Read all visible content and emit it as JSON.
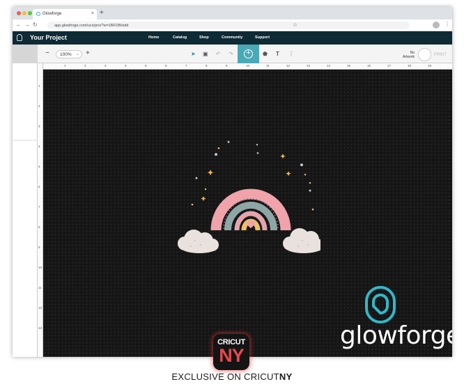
{
  "browser": {
    "tab_title": "Glowforge",
    "tab_close": "×",
    "new_tab": "+",
    "url": "app.glowforge.com/ucs/pro/?w=1BFOB/edit",
    "back": "←",
    "forward": "→",
    "reload": "↻",
    "star": "☆",
    "menu": "⋮",
    "colors": {
      "close": "#ee5e56",
      "minimize": "#f6be34",
      "maximize": "#5dc545"
    }
  },
  "app": {
    "project_title": "Your Project",
    "nav": [
      "Home",
      "Catalog",
      "Shop",
      "Community",
      "Support"
    ],
    "header_color": "#0d2a35",
    "accent": "#4aa8b7"
  },
  "toolbar": {
    "zoom_minus": "−",
    "zoom_value": "100%",
    "zoom_chevron": "⌄",
    "zoom_plus": "+",
    "select_tool": "➤",
    "image_tool": "▣",
    "undo": "↶",
    "redo": "↷",
    "add_art": "+",
    "shapes_tool": "⬟",
    "text_tool": "T",
    "more": "⋮",
    "status": "No Artwork",
    "print_label": "PRINT"
  },
  "rulers": {
    "horizontal": [
      "1",
      "2",
      "3",
      "4",
      "5",
      "6",
      "7",
      "8",
      "9",
      "10",
      "11",
      "12",
      "13",
      "14",
      "15",
      "16",
      "17",
      "18",
      "19"
    ],
    "vertical": [
      "1",
      "2",
      "3",
      "4",
      "5",
      "6",
      "7",
      "8",
      "9",
      "10",
      "11",
      "12",
      "13"
    ]
  },
  "canvas": {
    "artwork": "rainbow-with-heart-and-clouds",
    "brand_name": "glowforge",
    "bg_color": "#151515"
  },
  "watermark": {
    "badge_top": "CRICUT",
    "badge_bottom": "NY",
    "line_prefix": "EXCLUSIVE ON CRICUT",
    "line_suffix": "NY"
  }
}
